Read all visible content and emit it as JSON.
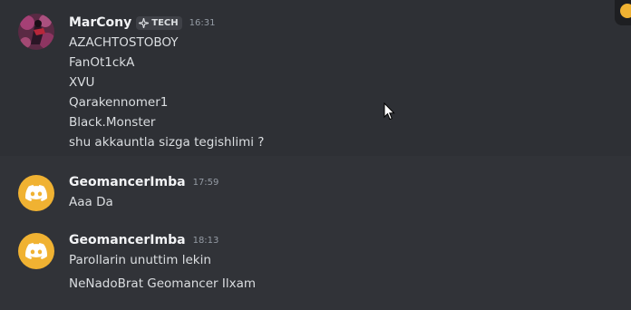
{
  "messages": [
    {
      "author": "MarCony",
      "tag": "TECH",
      "time": "16:31",
      "lines": [
        "AZACHTOSTOBOY",
        "FanOt1ckA",
        "XVU",
        "Qarakennomer1",
        "Black.Monster",
        "shu akkauntla sizga tegishlimi ?"
      ]
    },
    {
      "author": "GeomancerImba",
      "time": "17:59",
      "lines": [
        "Aaa Da"
      ]
    },
    {
      "author": "GeomancerImba",
      "time": "18:13",
      "lines": [
        "Parollarin unuttim lekin",
        "NeNadoBrat Geomancer Ilxam"
      ]
    }
  ],
  "colors": {
    "background": "#313338",
    "hover_background": "#2e3035",
    "discord_avatar": "#f0b232",
    "username": "#f2f3f5",
    "text": "#dbdee1",
    "timestamp": "#949ba4"
  },
  "icons": {
    "tag_icon": "sparkle-icon",
    "discord_avatar_icon": "discord-logo-icon",
    "corner": "reaction-emoji-icon",
    "cursor": "mouse-pointer-icon"
  }
}
